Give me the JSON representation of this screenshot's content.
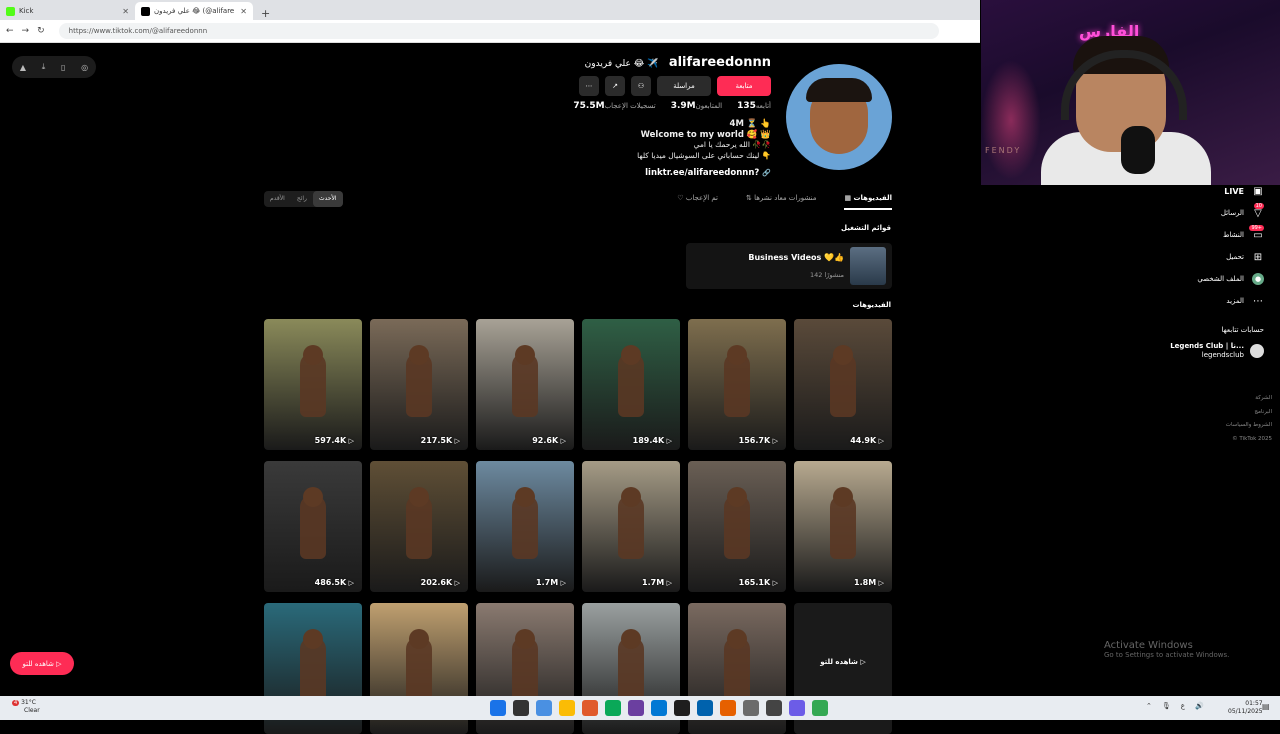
{
  "browser": {
    "tabs": [
      {
        "label": "Kick",
        "favicon_color": "#53fc18"
      },
      {
        "label": "علي فريدون 😂 (@alifareedonnn)",
        "favicon_color": "#000000"
      }
    ],
    "url": "https://www.tiktok.com/@alifareedonnn"
  },
  "webcam": {
    "overlay_logo": "الفارس",
    "background_text": "FENDY"
  },
  "profile": {
    "username": "alifareedonnn",
    "display_name": "علي فريدون 😂 ✈️",
    "buttons": {
      "follow": "متابعة",
      "message": "مراسلة"
    },
    "stats": [
      {
        "value": "135",
        "label": "أتابعه"
      },
      {
        "value": "3.9M",
        "label": "المتابعون"
      },
      {
        "value": "75.5M",
        "label": "تسجيلات الإعجاب"
      }
    ],
    "bio": [
      "4M ⏳ 👆",
      "Welcome to my world 🥰 👑",
      "الله يرحمك يا امي 🥀🥀",
      "لينك حساباتي على السوشيال ميديا كلها 👇"
    ],
    "link": "linktr.ee/alifareedonnn?"
  },
  "content_tabs": [
    {
      "label": "الفيديوهات",
      "active": true
    },
    {
      "label": "منشورات معاد نشرها",
      "active": false
    },
    {
      "label": "تم الإعجاب",
      "active": false
    }
  ],
  "sort": {
    "options": [
      "الأحدث",
      "رائج",
      "الأقدم"
    ],
    "selected": "الأحدث"
  },
  "playlists": {
    "heading": "قوائم التشغيل",
    "items": [
      {
        "title": "Business Videos 💛👍",
        "count": "142 منشورًا"
      }
    ]
  },
  "videos_heading": "الفيديوهات",
  "videos": [
    {
      "views": "597.4K",
      "bg": "#8a8a5a"
    },
    {
      "views": "217.5K",
      "bg": "#7a6a58"
    },
    {
      "views": "92.6K",
      "bg": "#a8a296"
    },
    {
      "views": "189.4K",
      "bg": "#2f5f45"
    },
    {
      "views": "156.7K",
      "bg": "#7e6e4e"
    },
    {
      "views": "44.9K",
      "bg": "#5a4a3a"
    },
    {
      "views": "486.5K",
      "bg": "#3a3a3a"
    },
    {
      "views": "202.6K",
      "bg": "#5f4f36"
    },
    {
      "views": "1.7M",
      "bg": "#6d8aa0"
    },
    {
      "views": "1.7M",
      "bg": "#a59b86"
    },
    {
      "views": "165.1K",
      "bg": "#6a5f55"
    },
    {
      "views": "1.8M",
      "bg": "#b8aa90"
    },
    {
      "views": "",
      "bg": "#2a6a7a"
    },
    {
      "views": "",
      "bg": "#c0a070"
    },
    {
      "views": "",
      "bg": "#8a7a70"
    },
    {
      "views": "",
      "bg": "#9aa0a0"
    },
    {
      "views": "",
      "bg": "#7a6a60"
    },
    {
      "views": "",
      "bg": "#1a1a1a",
      "more_label": "شاهده للتو ▷"
    }
  ],
  "sidebar": {
    "items": [
      {
        "label": "LIVE",
        "icon": "live-icon"
      },
      {
        "label": "الرسائل",
        "icon": "messages-icon",
        "badge": "10"
      },
      {
        "label": "النشاط",
        "icon": "activity-icon",
        "badge": "99+"
      },
      {
        "label": "تحميل",
        "icon": "upload-icon"
      },
      {
        "label": "الملف الشخصي",
        "icon": "profile-icon"
      },
      {
        "label": "المزيد",
        "icon": "more-icon"
      }
    ],
    "following_heading": "حسابات تتابعها",
    "following": [
      {
        "name": "Legends Club | نا...",
        "handle": "legendsclub"
      }
    ],
    "footer": [
      "الشركة",
      "البرنامج",
      "الشروط والسياسات",
      "© TikTok 2025"
    ]
  },
  "watch_button": "شاهده للتو ▷",
  "activate_windows": {
    "title": "Activate Windows",
    "subtitle": "Go to Settings to activate Windows."
  },
  "taskbar": {
    "temp": "31°C",
    "weather": "Clear",
    "weather_badge": "4",
    "time": "01:57",
    "date": "05/11/2025",
    "lang": "ع",
    "icon_colors": [
      "#1a73e8",
      "#333333",
      "#4a90e2",
      "#fbbc05",
      "#e05a2b",
      "#0aa858",
      "#6b3fa0",
      "#0078d4",
      "#1e1e1e",
      "#0062ad",
      "#e66000",
      "#6b6b6b",
      "#444444",
      "#6c5ce7",
      "#34a853"
    ]
  }
}
